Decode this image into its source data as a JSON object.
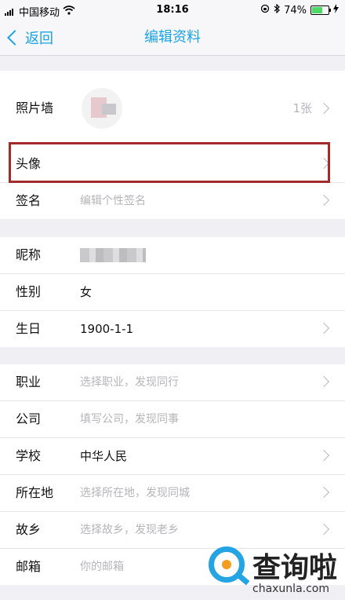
{
  "status_bar": {
    "carrier": "中国移动",
    "time": "18:16",
    "battery": "74%",
    "battery_level": 0.74
  },
  "nav": {
    "back_label": "返回",
    "title": "编辑资料"
  },
  "photo_wall": {
    "label": "照片墙",
    "count": "1张"
  },
  "avatar_row": {
    "label": "头像"
  },
  "signature_row": {
    "label": "签名",
    "placeholder": "编辑个性签名"
  },
  "profile": [
    {
      "label": "昵称",
      "value": ""
    },
    {
      "label": "性别",
      "value": "女"
    },
    {
      "label": "生日",
      "value": "1900-1-1"
    }
  ],
  "details": [
    {
      "label": "职业",
      "value": "选择职业，发现同行",
      "placeholder": true
    },
    {
      "label": "公司",
      "value": "填写公司，发现同事",
      "placeholder": true
    },
    {
      "label": "学校",
      "value": "中华人民",
      "placeholder": false
    },
    {
      "label": "所在地",
      "value": "选择所在地，发现同城",
      "placeholder": true
    },
    {
      "label": "故乡",
      "value": "选择故乡，发现老乡",
      "placeholder": true
    },
    {
      "label": "邮箱",
      "value": "你的邮箱",
      "placeholder": true
    }
  ],
  "watermark": {
    "text": "查询啦",
    "url": "chaxunla.com"
  },
  "colors": {
    "accent": "#1aa3e8",
    "highlight_border": "#a22a2a",
    "background": "#efeff4"
  }
}
